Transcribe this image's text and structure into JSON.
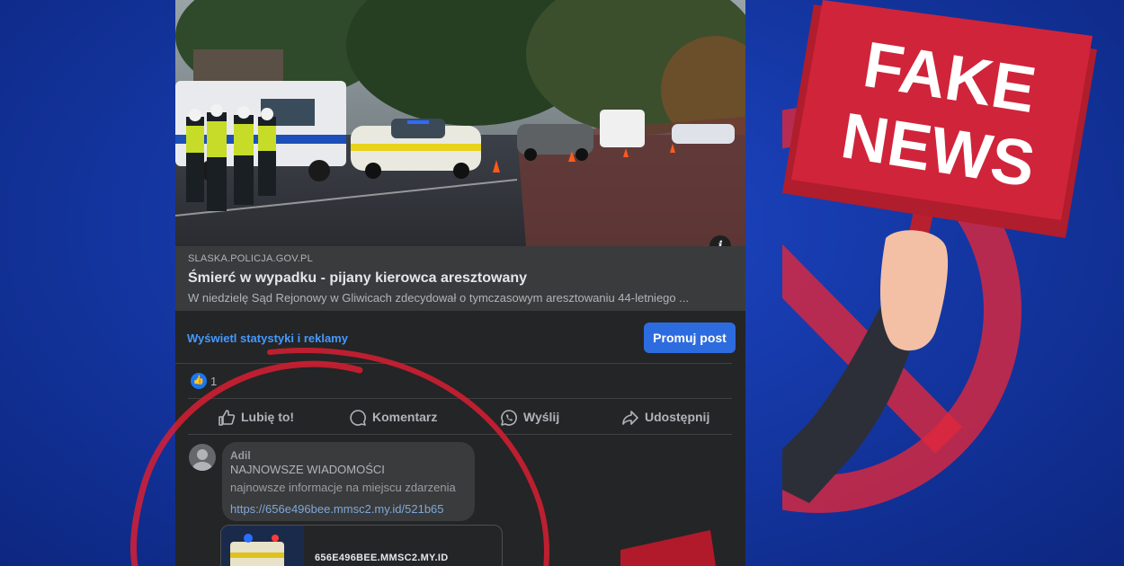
{
  "link_preview": {
    "domain": "SLASKA.POLICJA.GOV.PL",
    "title": "Śmierć w wypadku - pijany kierowca aresztowany",
    "description": "W niedzielę Sąd Rejonowy w Gliwicach zdecydował o tymczasowym aresztowaniu 44-letniego ..."
  },
  "post": {
    "stats_link": "Wyświetl statystyki i reklamy",
    "promote_button": "Promuj post",
    "reaction_count": "1",
    "actions": {
      "like": "Lubię to!",
      "comment": "Komentarz",
      "share_whatsapp": "Wyślij",
      "share": "Udostępnij"
    }
  },
  "comment": {
    "author": "Adil",
    "line1": "NAJNOWSZE WIADOMOŚCI",
    "line2": "najnowsze informacje na miejscu zdarzenia",
    "link": "https://656e496bee.mmsc2.my.id/521b65",
    "link_card_domain": "656E496BEE.MMSC2.MY.ID"
  },
  "sign": {
    "line1": "FAKE",
    "line2": "NEWS"
  },
  "icons": {
    "info": "info-icon",
    "like": "thumbs-up-icon",
    "comment": "speech-bubble-icon",
    "whatsapp": "whatsapp-icon",
    "share": "share-arrow-icon",
    "avatar": "default-avatar-icon",
    "prohibition": "prohibition-sign-icon"
  },
  "colors": {
    "background": "#1538a6",
    "card": "#242526",
    "link_blue": "#4599ff",
    "promote_button": "#2d6cdf",
    "sign_red": "#d0243a",
    "overlay_red": "#e0283c"
  }
}
